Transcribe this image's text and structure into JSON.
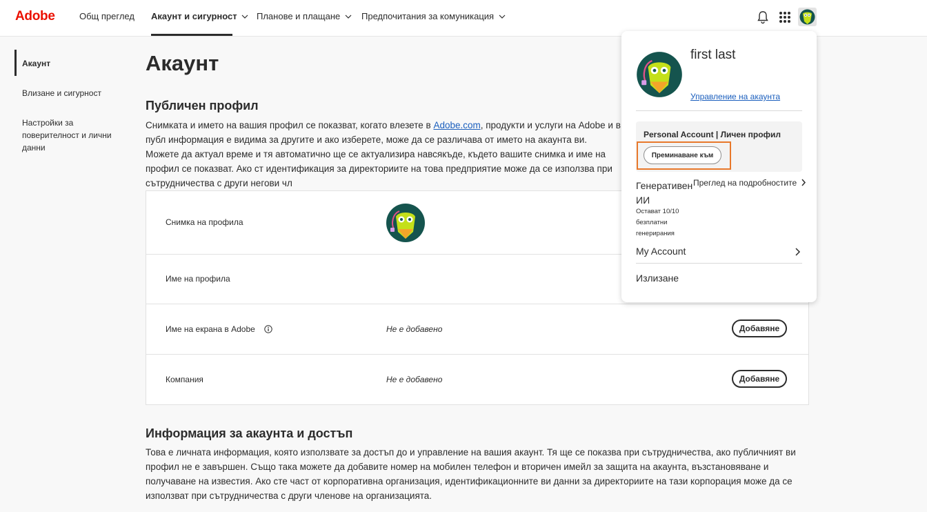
{
  "brand": {
    "logo": "Adobe",
    "logo_color": "#eb1000"
  },
  "topnav": {
    "items": [
      {
        "label": "Общ преглед"
      },
      {
        "label": "Акаунт и сигурност"
      },
      {
        "label": "Планове и плащане"
      },
      {
        "label": "Предпочитания за комуникация"
      }
    ],
    "icons": [
      "bell-icon",
      "apps-grid-icon",
      "avatar"
    ]
  },
  "sidebar": {
    "items": [
      {
        "label": "Акаунт"
      },
      {
        "label": "Влизане и сигурност"
      },
      {
        "label": "Настройки за поверителност и лични данни"
      }
    ]
  },
  "main": {
    "title": "Акаунт",
    "public_profile": {
      "heading": "Публичен профил",
      "text_before_link": "Снимката и името на вашия профил се показват, когато влезете в ",
      "link": "Adobe.com",
      "text_after_link": ", продукти и услуги на Adobe и в публ информация е видима за другите и ако изберете, може да се различава от името на акаунта ви. Можете да актуал време и тя автоматично ще се актуализира навсякъде, където вашите снимка и име на профил се показват. Ако ст идентификация за директориите на това предприятие може да се използва при сътрудничества с други негови чл"
    },
    "rows": [
      {
        "label": "Снимка на профила",
        "value": ""
      },
      {
        "label": "Име на профила",
        "value": ""
      },
      {
        "label": "Име на екрана в Adobe",
        "value": "Не е добавено",
        "button": "Добавяне"
      },
      {
        "label": "Компания",
        "value": "Не е добавено",
        "button": "Добавяне"
      }
    ],
    "account_info": {
      "heading": "Информация за акаунта и достъп",
      "text": "Това е личната информация, която използвате за достъп до и управление на вашия акаунт. Тя ще се показва при сътрудничества, ако публичният ви профил не е завършен. Също така можете да добавите номер на мобилен телефон и вторичен имейл за защита на акаунта, възстановяване и получаване на известия. Ако сте част от корпоративна организация, идентификационните ви данни за директориите на тази корпорация може да се използват при сътрудничества с други членове на организацията."
    }
  },
  "popover": {
    "name": "first last",
    "manage_link": "Управление на акаунта",
    "account_label": "Personal Account | Личен профил",
    "switch_button": "Преминаване към",
    "genai_title": "Генеративен ИИ",
    "genai_subtitle": "Остават 10/10 безплатни генерирания",
    "genai_link": "Преглед на подробностите",
    "my_account": "My Account",
    "sign_out": "Излизане",
    "highlight_color": "#e8782a"
  }
}
